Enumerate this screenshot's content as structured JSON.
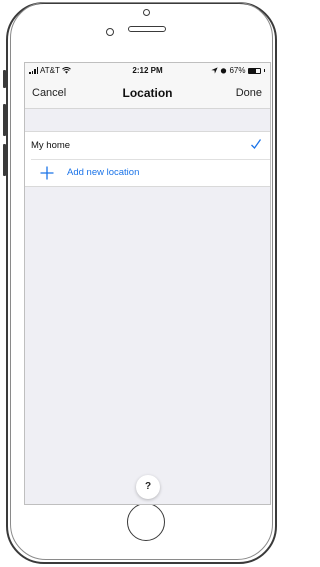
{
  "statusbar": {
    "carrier": "AT&T",
    "time": "2:12 PM",
    "battery_percent": "67%",
    "battery_level": 0.67
  },
  "navbar": {
    "cancel_label": "Cancel",
    "title": "Location",
    "done_label": "Done"
  },
  "locations": [
    {
      "label": "My home",
      "selected": true
    }
  ],
  "add_location_label": "Add new location",
  "help_label": "?",
  "colors": {
    "accent": "#1a73e8",
    "background": "#efeff4"
  },
  "icons": [
    "check-icon",
    "plus-icon",
    "wifi-icon",
    "location-arrow-icon",
    "alarm-icon",
    "battery-icon"
  ]
}
